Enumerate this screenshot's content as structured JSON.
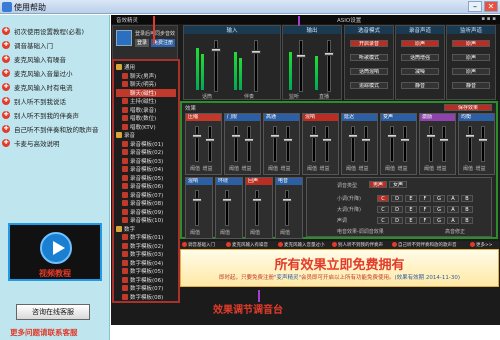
{
  "window": {
    "title": "使用帮助",
    "minimize": "–",
    "close": "✕"
  },
  "help": {
    "items": [
      {
        "label": "初次使用设置教程(必看)"
      },
      {
        "label": "调音基础入门"
      },
      {
        "label": "麦克风输入有噪音"
      },
      {
        "label": "麦克风输入音量过小"
      },
      {
        "label": "麦克风输入时有电流"
      },
      {
        "label": "别人听不到我说话"
      },
      {
        "label": "别人听不到我的伴奏声"
      },
      {
        "label": "自己听不到伴奏和放的歌声音"
      },
      {
        "label": "卡麦与高效说明"
      }
    ],
    "video_label": "视频教程",
    "consult_button": "咨询在线客服",
    "more_link": "更多问题请联系客服"
  },
  "app": {
    "title": "音效精灵",
    "asio_label": "ASIO设置",
    "menu_dots": "▪ ▪ ▪",
    "profile_text": "登录后可同步音效",
    "profile_login": "登录",
    "profile_sync": "免费注册",
    "presets": [
      {
        "label": "通用",
        "kind": "folder"
      },
      {
        "label": "聊天(男声)",
        "kind": "item"
      },
      {
        "label": "聊天(明亮)",
        "kind": "item"
      },
      {
        "label": "聊天(磁性)",
        "kind": "item",
        "selected": true
      },
      {
        "label": "主持(磁性)",
        "kind": "item"
      },
      {
        "label": "唱歌(录音)",
        "kind": "item"
      },
      {
        "label": "唱歌(数位)",
        "kind": "item"
      },
      {
        "label": "唱歌(KTV)",
        "kind": "item"
      },
      {
        "label": "录音",
        "kind": "folder"
      },
      {
        "label": "录音模板(01)",
        "kind": "item"
      },
      {
        "label": "录音模板(02)",
        "kind": "item"
      },
      {
        "label": "录音模板(03)",
        "kind": "item"
      },
      {
        "label": "录音模板(04)",
        "kind": "item"
      },
      {
        "label": "录音模板(05)",
        "kind": "item"
      },
      {
        "label": "录音模板(06)",
        "kind": "item"
      },
      {
        "label": "录音模板(07)",
        "kind": "item"
      },
      {
        "label": "录音模板(08)",
        "kind": "item"
      },
      {
        "label": "录音模板(09)",
        "kind": "item"
      },
      {
        "label": "录音模板(10)",
        "kind": "item"
      },
      {
        "label": "数字",
        "kind": "folder"
      },
      {
        "label": "数字模板(01)",
        "kind": "item"
      },
      {
        "label": "数字模板(02)",
        "kind": "item"
      },
      {
        "label": "数字模板(03)",
        "kind": "item"
      },
      {
        "label": "数字模板(04)",
        "kind": "item"
      },
      {
        "label": "数字模板(05)",
        "kind": "item"
      },
      {
        "label": "数字模板(06)",
        "kind": "item"
      },
      {
        "label": "数字模板(07)",
        "kind": "item"
      },
      {
        "label": "数字模板(08)",
        "kind": "item"
      }
    ],
    "input_label": "输入",
    "output_label": "输出",
    "input_ch1": "话筒",
    "input_ch2": "伴奏",
    "output_ch1": "监听",
    "output_ch2": "直播",
    "mode_header": "选音模式",
    "mode_buttons": [
      "开启录音",
      "听歌模式",
      "话筒混响",
      "追踪模式"
    ],
    "voice_header": "录音声道",
    "voice_buttons": [
      "原声",
      "话筒增强",
      "减噪",
      "静音"
    ],
    "mix_header": "监听声道",
    "mix_buttons": [
      "原声",
      "原声",
      "原声",
      "静音"
    ],
    "fx_label": "效果",
    "fx_button": "保存效果",
    "fx_row1": [
      "压缩",
      "门限",
      "高通",
      "混响",
      "延迟",
      "变声",
      "激励",
      "均衡"
    ],
    "fx_row2": [
      "混响",
      "环绕",
      "回声",
      "电音"
    ],
    "fx_sublabels": [
      "阈值",
      "增益"
    ],
    "electro_mode_label": "调音类型",
    "electro_mode_on": "男声",
    "electro_mode_off": "女声",
    "electro_key_label": "小调(升降)",
    "electro_scale_label": "大调(升降)",
    "electro_note_label": "声调",
    "keys": [
      "C",
      "D",
      "E",
      "F",
      "G",
      "A",
      "B"
    ],
    "electro_footer_left": "电音效果-调调音效果",
    "electro_footer_right": "高音修正",
    "bottom_links": [
      "调音基础入门",
      "麦克风输入有噪音",
      "麦克风输入音量过小",
      "别人听不到我的伴奏声",
      "自己听不到伴奏和放的歌声音",
      "更多>>"
    ],
    "banner_title": "所有效果立即免费拥有",
    "banner_text_a": "即时起，只要免费注册",
    "banner_highlight": "\"变声精灵\"",
    "banner_text_b": "会员即可开启以上所有功能免费使用。",
    "banner_date": "(效果有效期 2014-11-30)"
  },
  "caption": "效果调节调音台",
  "colors": {
    "accent_red": "#e23b2a",
    "help_bg": "#bfe6ef",
    "app_bg": "#1b1b1b",
    "annotation_purple": "#a23fd0"
  }
}
